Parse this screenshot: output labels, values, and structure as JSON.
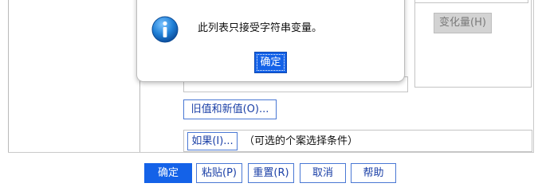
{
  "background_dialog": {
    "change_button_label": "变化量(H)",
    "old_new_button_label": "旧值和新值(O)...",
    "if_button_label": "如果(I)...",
    "optional_condition_text": "（可选的个案选择条件）",
    "footer": {
      "ok_label": "确定",
      "paste_label": "粘贴(P)",
      "reset_label": "重置(R)",
      "cancel_label": "取消",
      "help_label": "帮助"
    }
  },
  "message_box": {
    "icon": "info-icon",
    "message": "此列表只接受字符串变量。",
    "ok_label": "确定"
  },
  "colors": {
    "accent": "#1462e8",
    "icon_blue": "#1f7fd6"
  }
}
